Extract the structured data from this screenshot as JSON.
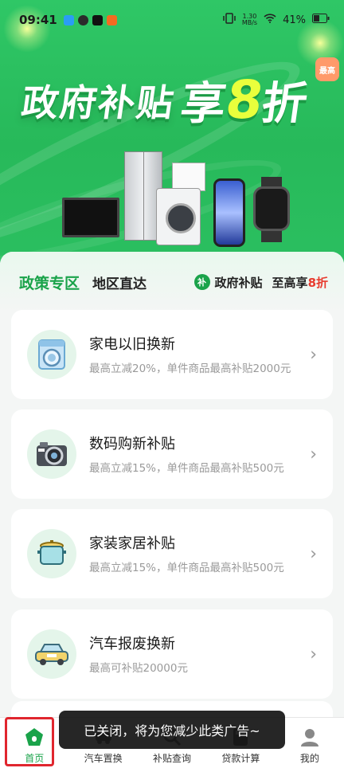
{
  "status_bar": {
    "time": "09:41",
    "net_speed_top": "1.30",
    "net_speed_bottom": "MB/s",
    "battery": "41%"
  },
  "banner": {
    "badge": "最高",
    "title_part1": "政府补贴",
    "title_part2": "享",
    "title_part3": "8",
    "title_part4": "折"
  },
  "tabs": {
    "active": "政策专区",
    "second": "地区直达",
    "gov_icon": "补",
    "gov_label": "政府补贴",
    "gov_prefix": "至高享",
    "gov_discount": "8折"
  },
  "cards": [
    {
      "title": "家电以旧换新",
      "desc": "最高立减20%，单件商品最高补贴2000元",
      "icon": "washing-machine-icon"
    },
    {
      "title": "数码购新补贴",
      "desc": "最高立减15%，单件商品最高补贴500元",
      "icon": "camera-icon"
    },
    {
      "title": "家装家居补贴",
      "desc": "最高立减15%，单件商品最高补贴500元",
      "icon": "cooking-pot-icon"
    },
    {
      "title": "汽车报废换新",
      "desc": "最高可补贴20000元",
      "icon": "car-icon"
    }
  ],
  "bottom_nav": [
    {
      "label": "首页",
      "icon": "home-icon"
    },
    {
      "label": "汽车置换",
      "icon": "car-exchange-icon"
    },
    {
      "label": "补贴查询",
      "icon": "search-icon"
    },
    {
      "label": "贷款计算",
      "icon": "calculator-icon"
    },
    {
      "label": "我的",
      "icon": "user-icon"
    }
  ],
  "toast": "已关闭，将为您减少此类广告~",
  "colors": {
    "brand_green": "#1aa34a",
    "banner_green": "#2fc766",
    "accent_yellow": "#e9ff3c",
    "alert_red": "#e83b2e"
  }
}
